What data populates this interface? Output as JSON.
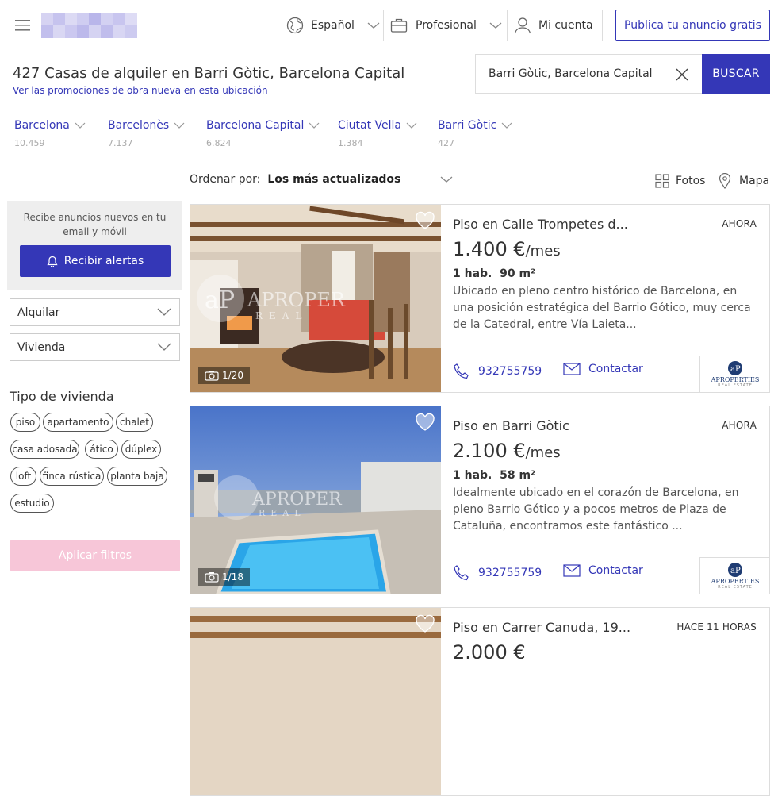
{
  "header": {
    "language": "Español",
    "professional": "Profesional",
    "account": "Mi cuenta",
    "publish": "Publica tu anuncio gratis"
  },
  "title": "427 Casas de alquiler en Barri Gòtic, Barcelona Capital",
  "new_developments_link": "Ver las promociones de obra nueva en esta ubicación",
  "search": {
    "value": "Barri Gòtic, Barcelona Capital",
    "button": "BUSCAR"
  },
  "breadcrumbs": [
    {
      "label": "Barcelona",
      "count": "10.459"
    },
    {
      "label": "Barcelonès",
      "count": "7.137"
    },
    {
      "label": "Barcelona Capital",
      "count": "6.824"
    },
    {
      "label": "Ciutat Vella",
      "count": "1.384"
    },
    {
      "label": "Barri Gòtic",
      "count": "427"
    }
  ],
  "sort": {
    "label": "Ordenar por:",
    "value": "Los más actualizados"
  },
  "view": {
    "photos": "Fotos",
    "map": "Mapa"
  },
  "alerts": {
    "text": "Recibe anuncios nuevos en tu email y móvil",
    "button": "Recibir alertas"
  },
  "filters": {
    "operation": "Alquilar",
    "property": "Vivienda",
    "type_heading": "Tipo de vivienda",
    "chips": [
      "piso",
      "apartamento",
      "chalet",
      "casa adosada",
      "ático",
      "dúplex",
      "loft",
      "finca rústica",
      "planta baja",
      "estudio"
    ],
    "apply": "Aplicar filtros"
  },
  "listings": [
    {
      "title": "Piso en Calle Trompetes d...",
      "time": "AHORA",
      "price": "1.400 €",
      "period": "/mes",
      "details": "1 hab.  90 m²",
      "description": "Ubicado en pleno centro histórico de Barcelona, en una posición estratégica del Barrio Gótico, muy cerca de la Catedral, entre Vía Laieta...",
      "photos": "1/20",
      "phone": "932755759",
      "contact": "Contactar",
      "agency": "APROPERTIES",
      "agency_sub": "REAL ESTATE",
      "watermark": "APROPER",
      "watermark_sub": "REAL"
    },
    {
      "title": "Piso en Barri Gòtic",
      "time": "AHORA",
      "price": "2.100 €",
      "period": "/mes",
      "details": "1 hab.  58 m²",
      "description": "Idealmente ubicado en el corazón de Barcelona, en pleno Barrio Gótico y a pocos metros de Plaza de Cataluña, encontramos este fantástico ...",
      "photos": "1/18",
      "phone": "932755759",
      "contact": "Contactar",
      "agency": "APROPERTIES",
      "agency_sub": "REAL ESTATE",
      "watermark": "APROPER",
      "watermark_sub": "REAL"
    },
    {
      "title": "Piso en Carrer Canuda, 19...",
      "time": "HACE 11 HORAS",
      "price": "2.000 €"
    }
  ],
  "colors": {
    "accent": "#3437b7",
    "apply_disabled": "#f7c6d8"
  }
}
